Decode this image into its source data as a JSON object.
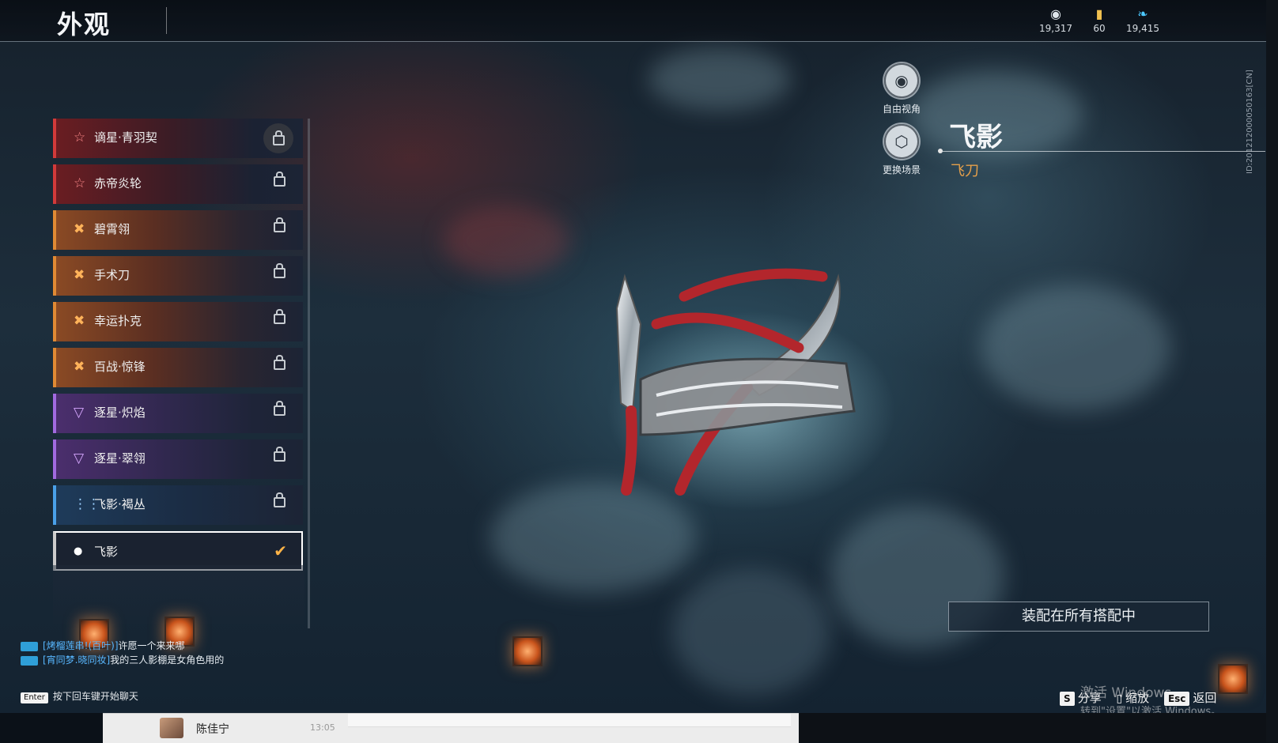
{
  "header": {
    "title": "外观"
  },
  "currencies": [
    {
      "icon": "silver-coin-icon",
      "value": "19,317",
      "color": "#dfe6ec"
    },
    {
      "icon": "gold-ticket-icon",
      "value": "60",
      "color": "#f0c050"
    },
    {
      "icon": "feather-icon",
      "value": "19,415",
      "color": "#4cc8ff"
    }
  ],
  "skins": [
    {
      "label": "谪星·青羽契",
      "rarity": "red",
      "locked": true
    },
    {
      "label": "赤帝炎轮",
      "rarity": "red",
      "locked": true
    },
    {
      "label": "碧霄翎",
      "rarity": "orange",
      "locked": true
    },
    {
      "label": "手术刀",
      "rarity": "orange",
      "locked": true
    },
    {
      "label": "幸运扑克",
      "rarity": "orange",
      "locked": true
    },
    {
      "label": "百战·惊锋",
      "rarity": "orange",
      "locked": true
    },
    {
      "label": "逐星·炽焰",
      "rarity": "purple",
      "locked": true
    },
    {
      "label": "逐星·翠翎",
      "rarity": "purple",
      "locked": true
    },
    {
      "label": "飞影·褐丛",
      "rarity": "blue",
      "locked": true
    },
    {
      "label": "飞影",
      "rarity": "white",
      "locked": false,
      "selected": true
    }
  ],
  "side_buttons": {
    "free_view": "自由视角",
    "change_scene": "更换场景"
  },
  "detail": {
    "name": "飞影",
    "type": "飞刀",
    "equip_all": "装配在所有搭配中",
    "vertical_id": "ID:201212000050163[CN]"
  },
  "chat": {
    "messages": [
      {
        "name": "[烤榴莲串!(百叶)]",
        "text": "许愿一个来来哪"
      },
      {
        "name": "[宵同梦.晓同妆]",
        "text": "我的三人影棚是女角色用的"
      }
    ],
    "enter_key": "Enter",
    "hint": "按下回车键开始聊天"
  },
  "hotkeys": [
    {
      "key": "S",
      "label": "分享"
    },
    {
      "key": "",
      "label": "缩放"
    },
    {
      "key": "Esc",
      "label": "返回"
    }
  ],
  "windows_activation": {
    "line1": "激活 Windows",
    "line2": "转到\"设置\"以激活 Windows。"
  },
  "taskbar": {
    "user": "陈佳宁",
    "time": "13:05"
  }
}
